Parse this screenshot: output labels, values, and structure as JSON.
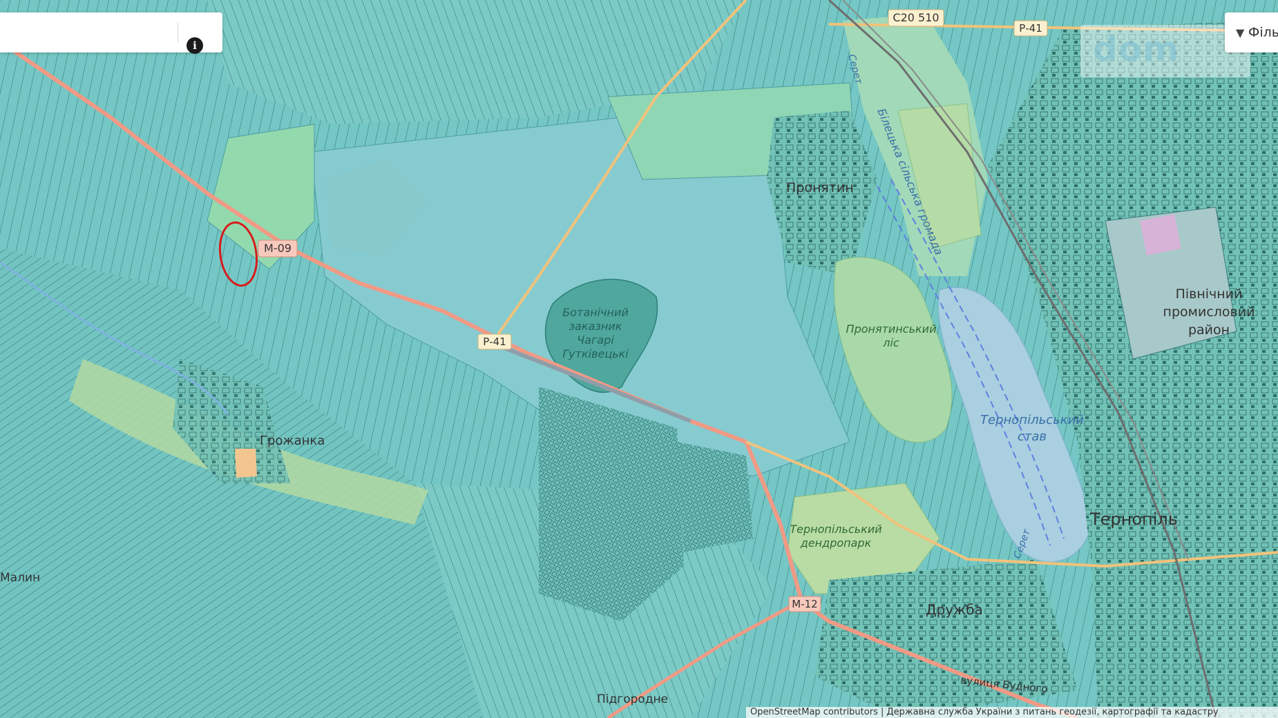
{
  "search": {
    "value": ""
  },
  "info_button": {
    "glyph": "i"
  },
  "filter_button": {
    "label": "Філь",
    "icon": "filter-icon"
  },
  "watermark": {
    "text": "dom"
  },
  "places": {
    "pronyatyn": "Пронятин",
    "botanical_1": "Ботанічний",
    "botanical_2": "заказник",
    "botanical_3": "Чагарі",
    "botanical_4": "Гутківецькі",
    "pronyatyn_forest_1": "Пронятинський",
    "pronyatyn_forest_2": "ліс",
    "industrial_1": "Північний",
    "industrial_2": "промисловий",
    "industrial_3": "район",
    "pond_1": "Тернопільський",
    "pond_2": "став",
    "ternopil": "Тернопіль",
    "dendropark_1": "Тернопільський",
    "dendropark_2": "дендропарк",
    "druzhba": "Дружба",
    "hrozhanka": "Грожанка",
    "left_village": "Малин",
    "bottom_village": "Підгородне",
    "bilecka": "Білецька сільська громада",
    "seret_1": "Серет",
    "seret_2": "Серет"
  },
  "roads": {
    "c20510": "C20 510",
    "r41_top": "Р-41",
    "m09": "М-09",
    "r41_mid": "Р-41",
    "m12": "М-12",
    "street_bottom": "вулиця Будного"
  },
  "attribution": "OpenStreetMap contributors | Державна служба України з питань геодезії, картографії та кадастру",
  "colors": {
    "parcels": "#74c7c4",
    "large_field": "#86cbd0",
    "forest": "#a9d9a9",
    "green_zone": "#9bd8a7",
    "water": "#a9cfe0",
    "road_primary": "#f09a85",
    "road_secondary": "#f2c27b",
    "road_grey": "#8f9ea8",
    "marker": "#d91b1b"
  },
  "marker": {
    "shape": "ellipse"
  }
}
